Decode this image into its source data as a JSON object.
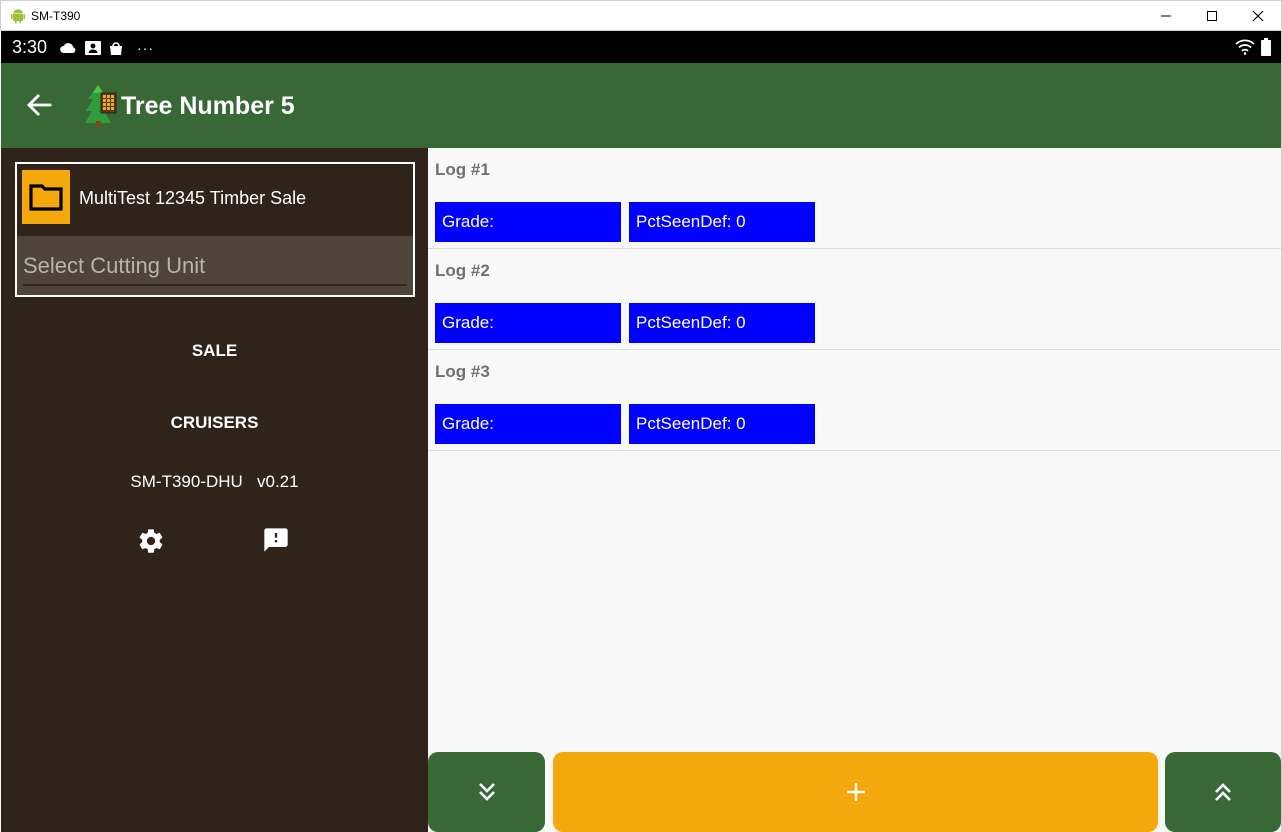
{
  "window": {
    "title": "SM-T390",
    "controls": [
      "minimize-icon",
      "maximize-icon",
      "close-icon"
    ]
  },
  "status_bar": {
    "time": "3:30",
    "dots": "···",
    "left_icons": [
      "cloud-icon",
      "contact-card-icon",
      "bag-icon"
    ],
    "right_icons": [
      "wifi-icon",
      "battery-icon"
    ]
  },
  "app_bar": {
    "title": "Tree Number 5",
    "color": "#376836",
    "back_icon": "arrow-left-icon",
    "logo_icon": "tree-logo-icon"
  },
  "sidebar": {
    "sale_name": "MultiTest 12345 Timber Sale",
    "cutting_unit_placeholder": "Select Cutting Unit",
    "menu": [
      {
        "label": "SALE"
      },
      {
        "label": "CRUISERS"
      }
    ],
    "device": "SM-T390-DHU",
    "version": "v0.21",
    "icons": [
      "settings-gear-icon",
      "feedback-icon"
    ]
  },
  "logs": [
    {
      "title": "Log #1",
      "grade": "Grade:",
      "pct": "PctSeenDef: 0"
    },
    {
      "title": "Log #2",
      "grade": "Grade:",
      "pct": "PctSeenDef: 0"
    },
    {
      "title": "Log #3",
      "grade": "Grade:",
      "pct": "PctSeenDef: 0"
    }
  ],
  "bottom_bar": {
    "scroll_down_icon": "double-chevron-down-icon",
    "add_icon": "plus-icon",
    "scroll_up_icon": "double-chevron-up-icon"
  },
  "colors": {
    "green": "#376836",
    "accent": "#f5a80b",
    "field_blue": "#0000ff",
    "sidebar_bg": "#30241a"
  }
}
